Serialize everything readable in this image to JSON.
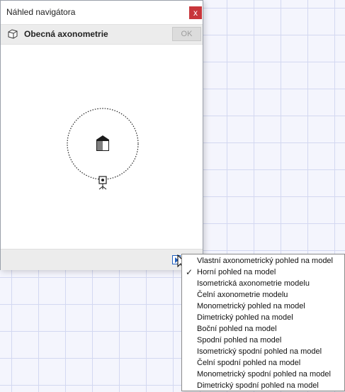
{
  "window": {
    "title": "Náhled navigátora",
    "close_label": "x"
  },
  "toolbar": {
    "view_icon": "box-icon",
    "view_name": "Obecná axonometrie",
    "ok_label": "OK"
  },
  "preview": {
    "model_icon": "house-icon",
    "camera_icon": "camera-icon"
  },
  "bottombar": {
    "menu_button_icon": "triangle-right-icon"
  },
  "menu": {
    "check_mark": "✓",
    "items": [
      {
        "label": "Vlastní axonometrický pohled na model",
        "checked": false
      },
      {
        "label": "Horní pohled na model",
        "checked": true
      },
      {
        "label": "Isometrická axonometrie modelu",
        "checked": false
      },
      {
        "label": "Čelní axonometrie modelu",
        "checked": false
      },
      {
        "label": "Monometrický pohled na model",
        "checked": false
      },
      {
        "label": "Dimetrický pohled na model",
        "checked": false
      },
      {
        "label": "Boční pohled na model",
        "checked": false
      },
      {
        "label": "Spodní pohled na model",
        "checked": false
      },
      {
        "label": "Isometrický spodní pohled na model",
        "checked": false
      },
      {
        "label": "Čelní spodní pohled na model",
        "checked": false
      },
      {
        "label": "Monometrický spodní pohled na model",
        "checked": false
      },
      {
        "label": "Dimetrický spodní pohled na model",
        "checked": false
      }
    ]
  }
}
